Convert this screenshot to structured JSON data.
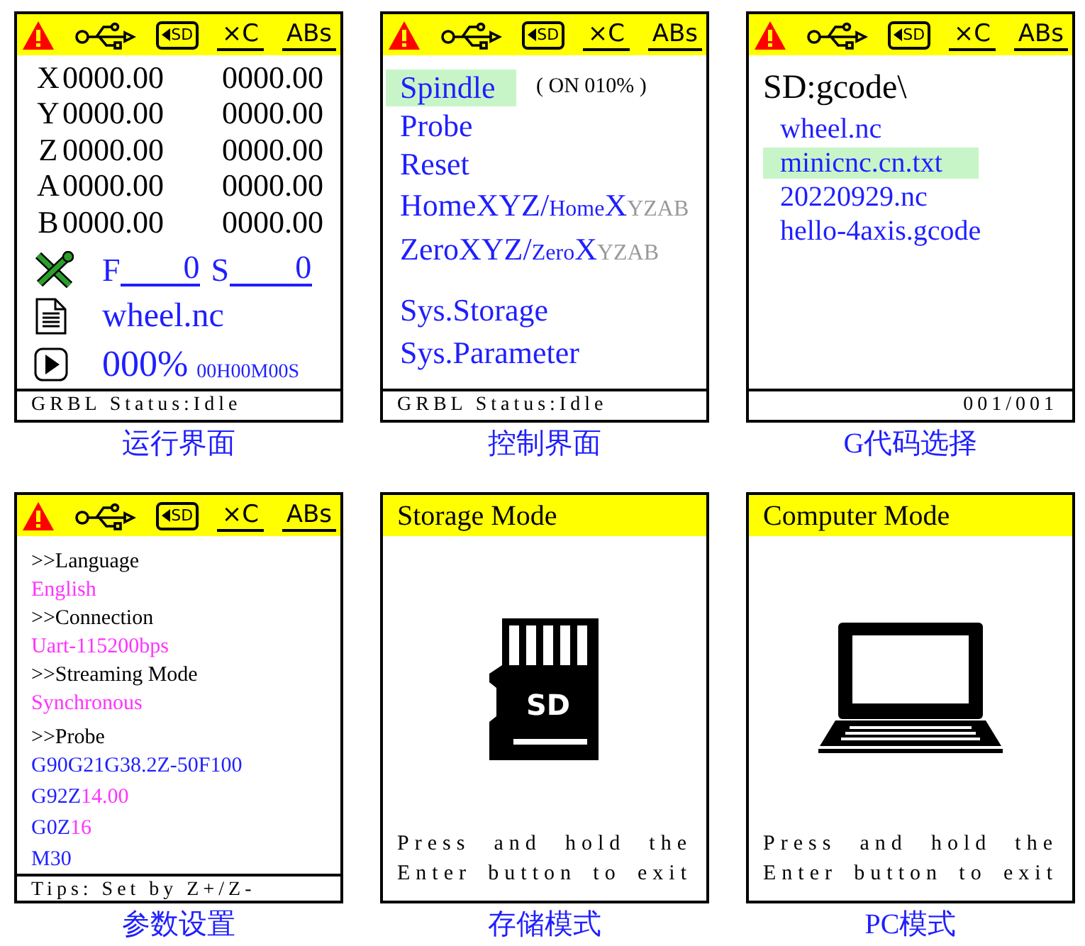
{
  "screens": [
    {
      "kind": "run",
      "header": {
        "kind": "status",
        "items": [
          {
            "kind": "warning"
          },
          {
            "kind": "usb"
          },
          {
            "kind": "sd",
            "text": "SD"
          },
          {
            "kind": "label",
            "text": "×C"
          },
          {
            "kind": "label",
            "text": "ABs"
          }
        ]
      },
      "axes": [
        {
          "axis": "X",
          "work": "0000.00",
          "machine": "0000.00"
        },
        {
          "axis": "Y",
          "work": "0000.00",
          "machine": "0000.00"
        },
        {
          "axis": "Z",
          "work": "0000.00",
          "machine": "0000.00"
        },
        {
          "axis": "A",
          "work": "0000.00",
          "machine": "0000.00"
        },
        {
          "axis": "B",
          "work": "0000.00",
          "machine": "0000.00"
        }
      ],
      "feed": {
        "label": "F",
        "value": "0"
      },
      "spindle": {
        "label": "S",
        "value": "0"
      },
      "file": "wheel.nc",
      "progress": "000%",
      "elapsed": "00H00M00S",
      "footer": "GRBL Status:Idle",
      "caption": "运行界面"
    },
    {
      "kind": "control",
      "header": {
        "kind": "status",
        "items": [
          {
            "kind": "warning"
          },
          {
            "kind": "usb"
          },
          {
            "kind": "sd",
            "text": "SD"
          },
          {
            "kind": "label",
            "text": "×C"
          },
          {
            "kind": "label",
            "text": "ABs"
          }
        ]
      },
      "menu": [
        {
          "parts": [
            {
              "text": "Spindle"
            }
          ],
          "selected": true,
          "note": "( ON 010% )"
        },
        {
          "parts": [
            {
              "text": "Probe"
            }
          ],
          "selected": false
        },
        {
          "parts": [
            {
              "text": "Reset"
            }
          ],
          "selected": false
        },
        {
          "parts": [
            {
              "text": "HomeXYZ/"
            },
            {
              "text": "Home",
              "kind": "minor"
            },
            {
              "text": "X"
            },
            {
              "text": "YZAB",
              "kind": "minor",
              "disabled": true
            }
          ],
          "selected": false
        },
        {
          "parts": [
            {
              "text": "ZeroXYZ/"
            },
            {
              "text": "Zero",
              "kind": "minor"
            },
            {
              "text": "X"
            },
            {
              "text": "YZAB",
              "kind": "minor",
              "disabled": true
            }
          ],
          "selected": false
        }
      ],
      "system_menu": [
        {
          "parts": [
            {
              "text": "Sys.Storage"
            }
          ],
          "selected": false
        },
        {
          "parts": [
            {
              "text": "Sys.Parameter"
            }
          ],
          "selected": false
        }
      ],
      "footer": "GRBL Status:Idle",
      "caption": "控制界面"
    },
    {
      "kind": "files",
      "header": {
        "kind": "status",
        "items": [
          {
            "kind": "warning"
          },
          {
            "kind": "usb"
          },
          {
            "kind": "sd",
            "text": "SD"
          },
          {
            "kind": "label",
            "text": "×C"
          },
          {
            "kind": "label",
            "text": "ABs"
          }
        ]
      },
      "path": "SD:gcode\\",
      "files": [
        {
          "name": "wheel.nc",
          "selected": false
        },
        {
          "name": "minicnc.cn.txt",
          "selected": true
        },
        {
          "name": "20220929.nc",
          "selected": false
        },
        {
          "name": "hello-4axis.gcode",
          "selected": false
        }
      ],
      "footer": "001/001",
      "caption": "G代码选择"
    },
    {
      "kind": "settings",
      "header": {
        "kind": "status",
        "items": [
          {
            "kind": "warning"
          },
          {
            "kind": "usb"
          },
          {
            "kind": "sd",
            "text": "SD"
          },
          {
            "kind": "label",
            "text": "×C"
          },
          {
            "kind": "label",
            "text": "ABs"
          }
        ]
      },
      "settings": [
        {
          "label": ">>Language",
          "lines": [
            [
              {
                "text": "English",
                "kind": "value"
              }
            ]
          ]
        },
        {
          "label": ">>Connection",
          "lines": [
            [
              {
                "text": "Uart-115200bps",
                "kind": "value"
              }
            ]
          ]
        },
        {
          "label": ">>Streaming Mode",
          "lines": [
            [
              {
                "text": "Synchronous",
                "kind": "value"
              }
            ]
          ]
        },
        {
          "label": ">>Probe",
          "lines": [
            [
              {
                "text": "G90G21G38.2Z-50F100",
                "kind": "code"
              }
            ],
            [
              {
                "text": "G92Z",
                "kind": "code"
              },
              {
                "text": "14.00",
                "kind": "value"
              }
            ],
            [
              {
                "text": "G0Z",
                "kind": "code"
              },
              {
                "text": "16",
                "kind": "value"
              }
            ],
            [
              {
                "text": "M30",
                "kind": "code"
              }
            ]
          ]
        }
      ],
      "footer": "Tips: Set by Z+/Z-",
      "caption": "参数设置"
    },
    {
      "kind": "mode",
      "header": {
        "kind": "title",
        "title": "Storage Mode"
      },
      "picture": {
        "kind": "sd_card",
        "label": "SD"
      },
      "message": [
        "Press and hold the",
        "Enter button to exit"
      ],
      "caption": "存储模式"
    },
    {
      "kind": "mode",
      "header": {
        "kind": "title",
        "title": "Computer Mode"
      },
      "picture": {
        "kind": "laptop"
      },
      "message": [
        "Press and hold the",
        "Enter button to exit"
      ],
      "caption": "PC模式"
    }
  ]
}
